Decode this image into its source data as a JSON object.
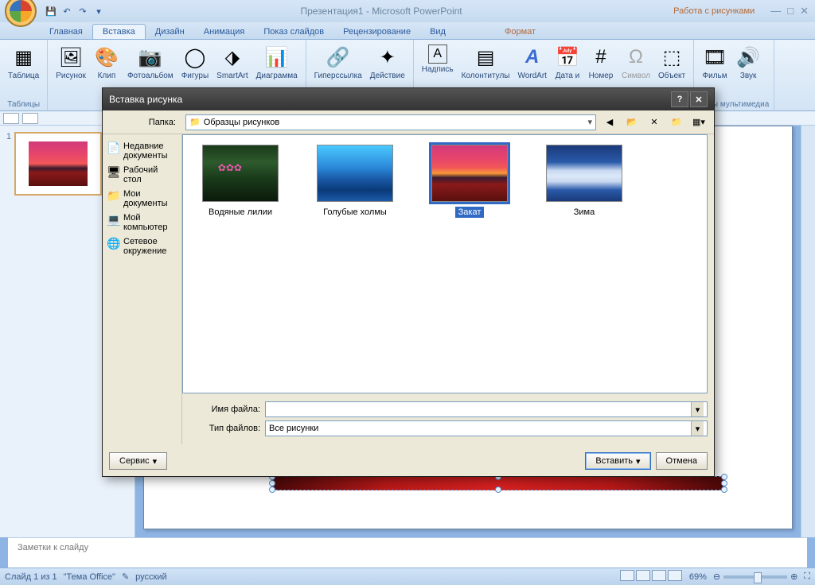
{
  "app": {
    "title": "Презентация1 - Microsoft PowerPoint",
    "context_title": "Работа с рисунками"
  },
  "tabs": {
    "home": "Главная",
    "insert": "Вставка",
    "design": "Дизайн",
    "animation": "Анимация",
    "slideshow": "Показ слайдов",
    "review": "Рецензирование",
    "view": "Вид",
    "format": "Формат"
  },
  "ribbon": {
    "table": "Таблица",
    "tables_group": "Таблицы",
    "picture": "Рисунок",
    "clip": "Клип",
    "photoalbum": "Фотоальбом",
    "shapes": "Фигуры",
    "smartart": "SmartArt",
    "chart": "Диаграмма",
    "hyperlink": "Гиперссылка",
    "action": "Действие",
    "textbox": "Надпись",
    "headerfooter": "Колонтитулы",
    "wordart": "WordArt",
    "datetime": "Дата и",
    "number": "Номер",
    "symbol": "Символ",
    "object": "Объект",
    "movie": "Фильм",
    "sound": "Звук",
    "media_group": "липы мультимедиа"
  },
  "dialog": {
    "title": "Вставка рисунка",
    "folder_label": "Папка:",
    "folder_value": "Образцы рисунков",
    "side": {
      "recent": "Недавние документы",
      "desktop": "Рабочий стол",
      "mydocs": "Мои документы",
      "mycomp": "Мой компьютер",
      "network": "Сетевое окружение"
    },
    "files": {
      "f1": "Водяные лилии",
      "f2": "Голубые холмы",
      "f3": "Закат",
      "f4": "Зима"
    },
    "filename_label": "Имя файла:",
    "filename_value": "",
    "filetype_label": "Тип файлов:",
    "filetype_value": "Все рисунки",
    "service": "Сервис",
    "insert": "Вставить",
    "cancel": "Отмена"
  },
  "notes": {
    "placeholder": "Заметки к слайду"
  },
  "status": {
    "slide": "Слайд 1 из 1",
    "theme": "\"Тема Office\"",
    "lang": "русский",
    "zoom": "69%"
  }
}
